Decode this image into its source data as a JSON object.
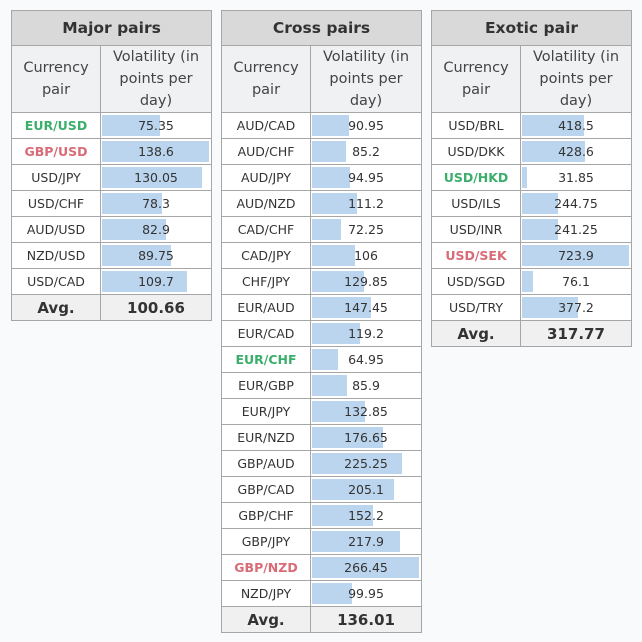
{
  "colors": {
    "bar": "#bcd5ee",
    "lowest_highlight": "#3cae6c",
    "highest_highlight": "#d96b77"
  },
  "tables": [
    {
      "id": "major",
      "title": "Major pairs",
      "col_pair": "Currency pair",
      "col_vol": "Volatility (in points per day)",
      "avg_label": "Avg.",
      "avg": "100.66",
      "rows": [
        {
          "pair": "EUR/USD",
          "value": "75.35",
          "highlight": "low"
        },
        {
          "pair": "GBP/USD",
          "value": "138.6",
          "highlight": "high"
        },
        {
          "pair": "USD/JPY",
          "value": "130.05",
          "highlight": ""
        },
        {
          "pair": "USD/CHF",
          "value": "78.3",
          "highlight": ""
        },
        {
          "pair": "AUD/USD",
          "value": "82.9",
          "highlight": ""
        },
        {
          "pair": "NZD/USD",
          "value": "89.75",
          "highlight": ""
        },
        {
          "pair": "USD/CAD",
          "value": "109.7",
          "highlight": ""
        }
      ]
    },
    {
      "id": "cross",
      "title": "Cross pairs",
      "col_pair": "Currency pair",
      "col_vol": "Volatility (in points per day)",
      "avg_label": "Avg.",
      "avg": "136.01",
      "rows": [
        {
          "pair": "AUD/CAD",
          "value": "90.95",
          "highlight": ""
        },
        {
          "pair": "AUD/CHF",
          "value": "85.2",
          "highlight": ""
        },
        {
          "pair": "AUD/JPY",
          "value": "94.95",
          "highlight": ""
        },
        {
          "pair": "AUD/NZD",
          "value": "111.2",
          "highlight": ""
        },
        {
          "pair": "CAD/CHF",
          "value": "72.25",
          "highlight": ""
        },
        {
          "pair": "CAD/JPY",
          "value": "106",
          "highlight": ""
        },
        {
          "pair": "CHF/JPY",
          "value": "129.85",
          "highlight": ""
        },
        {
          "pair": "EUR/AUD",
          "value": "147.45",
          "highlight": ""
        },
        {
          "pair": "EUR/CAD",
          "value": "119.2",
          "highlight": ""
        },
        {
          "pair": "EUR/CHF",
          "value": "64.95",
          "highlight": "low"
        },
        {
          "pair": "EUR/GBP",
          "value": "85.9",
          "highlight": ""
        },
        {
          "pair": "EUR/JPY",
          "value": "132.85",
          "highlight": ""
        },
        {
          "pair": "EUR/NZD",
          "value": "176.65",
          "highlight": ""
        },
        {
          "pair": "GBP/AUD",
          "value": "225.25",
          "highlight": ""
        },
        {
          "pair": "GBP/CAD",
          "value": "205.1",
          "highlight": ""
        },
        {
          "pair": "GBP/CHF",
          "value": "152.2",
          "highlight": ""
        },
        {
          "pair": "GBP/JPY",
          "value": "217.9",
          "highlight": ""
        },
        {
          "pair": "GBP/NZD",
          "value": "266.45",
          "highlight": "high"
        },
        {
          "pair": "NZD/JPY",
          "value": "99.95",
          "highlight": ""
        }
      ]
    },
    {
      "id": "exotic",
      "title": "Exotic pair",
      "col_pair": "Currency pair",
      "col_vol": "Volatility (in points per day)",
      "avg_label": "Avg.",
      "avg": "317.77",
      "rows": [
        {
          "pair": "USD/BRL",
          "value": "418.5",
          "highlight": ""
        },
        {
          "pair": "USD/DKK",
          "value": "428.6",
          "highlight": ""
        },
        {
          "pair": "USD/HKD",
          "value": "31.85",
          "highlight": "low"
        },
        {
          "pair": "USD/ILS",
          "value": "244.75",
          "highlight": ""
        },
        {
          "pair": "USD/INR",
          "value": "241.25",
          "highlight": ""
        },
        {
          "pair": "USD/SEK",
          "value": "723.9",
          "highlight": "high"
        },
        {
          "pair": "USD/SGD",
          "value": "76.1",
          "highlight": ""
        },
        {
          "pair": "USD/TRY",
          "value": "377.2",
          "highlight": ""
        }
      ]
    }
  ]
}
